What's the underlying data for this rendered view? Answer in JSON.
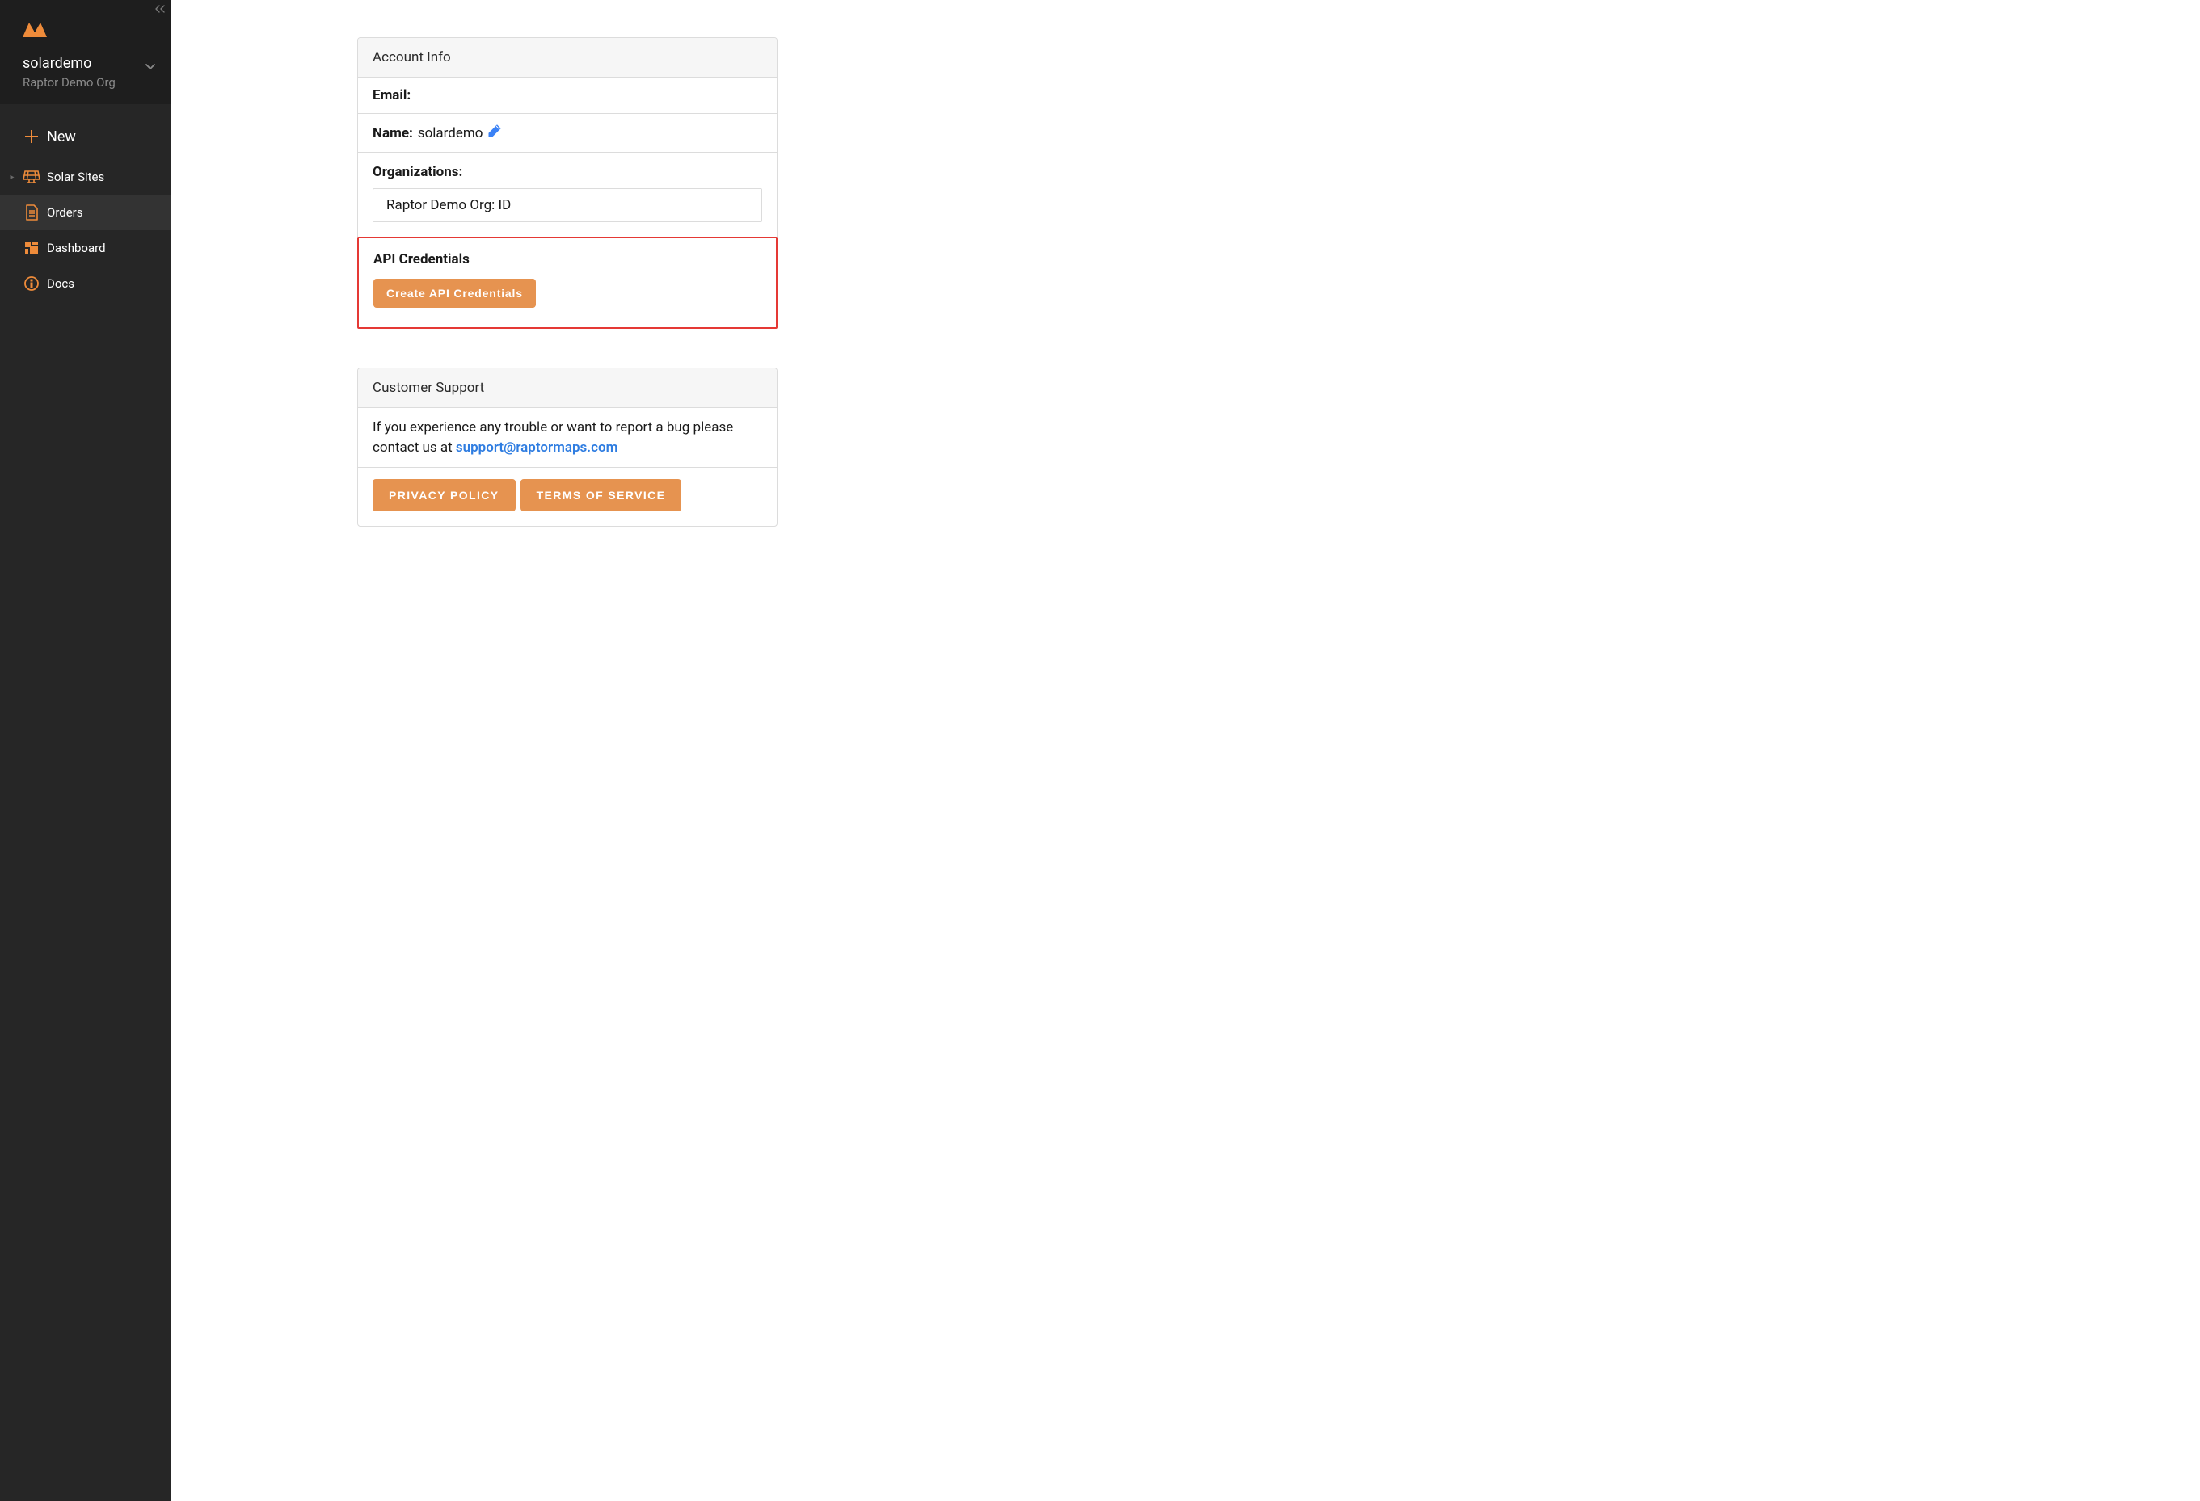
{
  "sidebar": {
    "user": "solardemo",
    "org": "Raptor Demo Org",
    "items": {
      "new": "New",
      "solar_sites": "Solar Sites",
      "orders": "Orders",
      "dashboard": "Dashboard",
      "docs": "Docs"
    }
  },
  "account": {
    "header": "Account Info",
    "email_label": "Email:",
    "email_value": "",
    "name_label": "Name:",
    "name_value": "solardemo",
    "orgs_label": "Organizations:",
    "org_entry": "Raptor Demo Org: ID",
    "api_header": "API Credentials",
    "api_button": "Create API Credentials"
  },
  "support": {
    "header": "Customer Support",
    "text_before": "If you experience any trouble or want to report a bug please contact us at ",
    "email": "support@raptormaps.com",
    "privacy": "PRIVACY POLICY",
    "terms": "TERMS OF SERVICE"
  }
}
